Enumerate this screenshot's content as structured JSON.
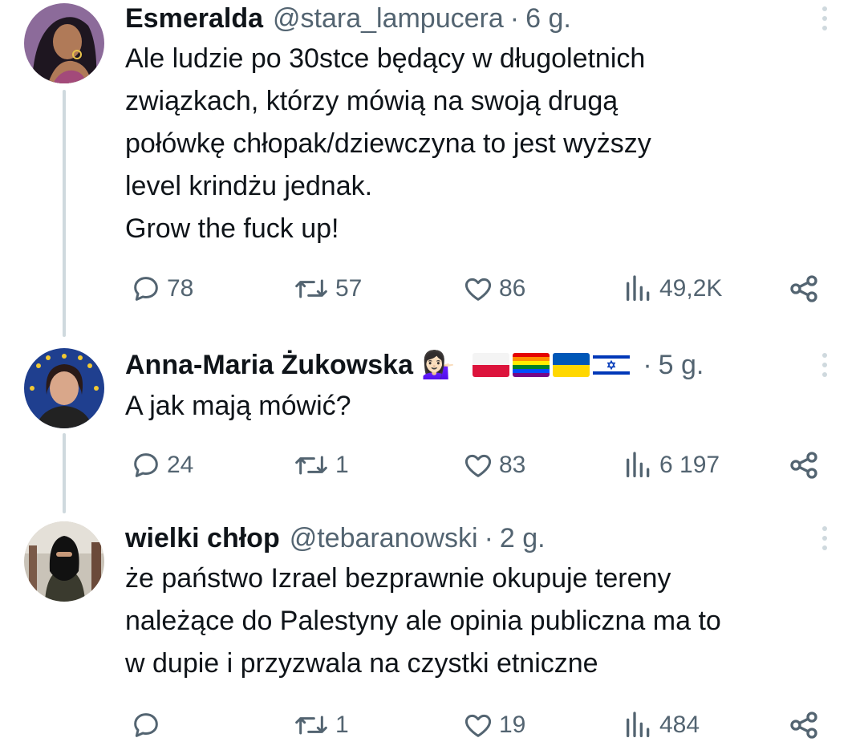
{
  "tweets": [
    {
      "name": "Esmeralda",
      "handle": "@stara_lampucera",
      "separator": "·",
      "time": "6 g.",
      "lines": [
        "Ale ludzie po 30stce będący w długoletnich",
        "związkach, którzy mówią na swoją drugą",
        "połówkę chłopak/dziewczyna to jest wyższy",
        "level krindżu jednak.",
        "Grow the fuck up!"
      ],
      "replies": "78",
      "retweets": "57",
      "likes": "86",
      "views": "49,2K"
    },
    {
      "name": "Anna-Maria Żukowska",
      "handle": "",
      "separator": "·",
      "time": "5 g.",
      "emoji_person": "💁🏻‍♀️",
      "flags": [
        "poland-flag",
        "rainbow-flag",
        "ukraine-flag",
        "israel-flag"
      ],
      "lines": [
        "A jak mają mówić?"
      ],
      "replies": "24",
      "retweets": "1",
      "likes": "83",
      "views": "6 197"
    },
    {
      "name": "wielki chłop",
      "handle": "@tebaranowski",
      "separator": "·",
      "time": "2 g.",
      "lines": [
        "że państwo Izrael bezprawnie okupuje tereny",
        "należące do Palestyny ale opinia publiczna ma to",
        "w dupie i przyzwala na czystki etniczne"
      ],
      "replies": "",
      "retweets": "1",
      "likes": "19",
      "views": "484"
    }
  ],
  "colors": {
    "text": "#0f1419",
    "secondary": "#536471",
    "thread_line": "#cfd9de"
  },
  "icons": [
    "reply-icon",
    "retweet-icon",
    "like-icon",
    "views-icon",
    "share-icon",
    "more-icon"
  ]
}
